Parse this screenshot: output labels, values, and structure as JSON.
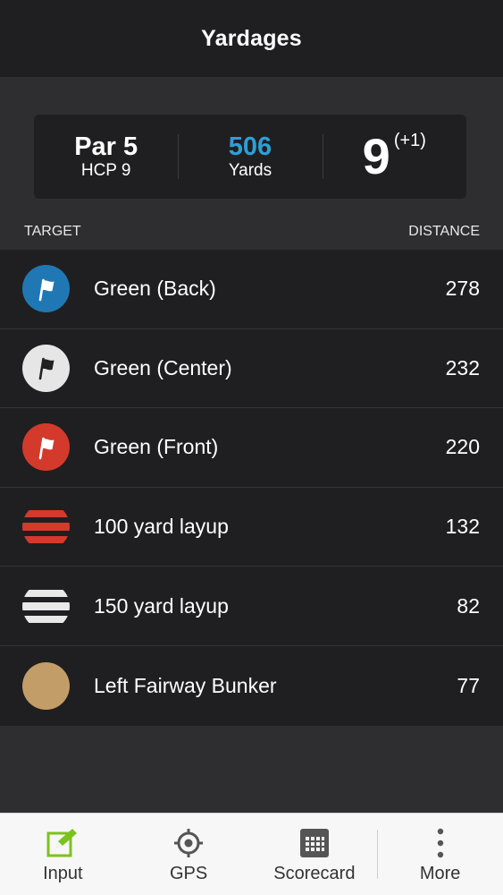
{
  "header": {
    "title": "Yardages"
  },
  "hole": {
    "par": "Par 5",
    "hcp": "HCP 9",
    "yards_value": "506",
    "yards_label": "Yards",
    "score": "9",
    "score_diff": "(+1)"
  },
  "list_header": {
    "target": "TARGET",
    "distance": "DISTANCE"
  },
  "targets": [
    {
      "label": "Green (Back)",
      "distance": "278",
      "icon": "flag-blue-icon"
    },
    {
      "label": "Green (Center)",
      "distance": "232",
      "icon": "flag-white-icon"
    },
    {
      "label": "Green (Front)",
      "distance": "220",
      "icon": "flag-red-icon"
    },
    {
      "label": "100 yard layup",
      "distance": "132",
      "icon": "red-stripe-icon"
    },
    {
      "label": "150 yard layup",
      "distance": "82",
      "icon": "white-stripe-icon"
    },
    {
      "label": "Left Fairway Bunker",
      "distance": "77",
      "icon": "bunker-icon"
    }
  ],
  "colors": {
    "accent_blue": "#2e9fd6",
    "flag_blue": "#1f78b4",
    "flag_white": "#e6e6e6",
    "flag_red": "#d33a2c",
    "bunker": "#c39d68",
    "input_green": "#7cc21e"
  },
  "tabbar": {
    "input": "Input",
    "gps": "GPS",
    "scorecard": "Scorecard",
    "more": "More"
  }
}
